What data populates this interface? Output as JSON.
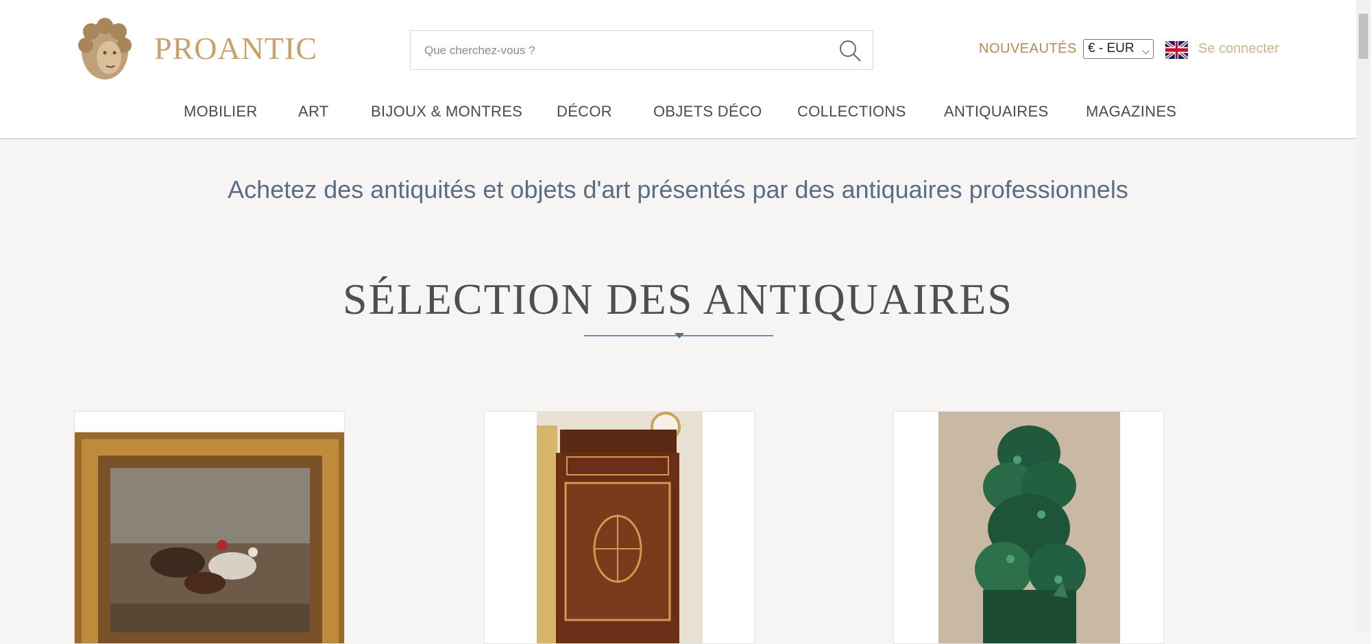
{
  "header": {
    "logo_text": "PROANTIC",
    "search_placeholder": "Que cherchez-vous ?",
    "nouveautes": "NOUVEAUTÉS",
    "currency": "€ - EUR",
    "login": "Se connecter"
  },
  "nav": {
    "items": [
      "MOBILIER",
      "ART",
      "BIJOUX & MONTRES",
      "DÉCOR",
      "OBJETS DÉCO",
      "COLLECTIONS",
      "ANTIQUAIRES",
      "MAGAZINES"
    ]
  },
  "main": {
    "tagline": "Achetez des antiquités et objets d'art présentés par des antiquaires professionnels",
    "section_title": "SÉLECTION DES ANTIQUAIRES"
  },
  "colors": {
    "accent_gold": "#b08c54",
    "title_blue": "#5a6d86"
  },
  "icons": [
    "search-icon",
    "chevron-down-icon",
    "uk-flag-icon",
    "logo-head-icon"
  ]
}
